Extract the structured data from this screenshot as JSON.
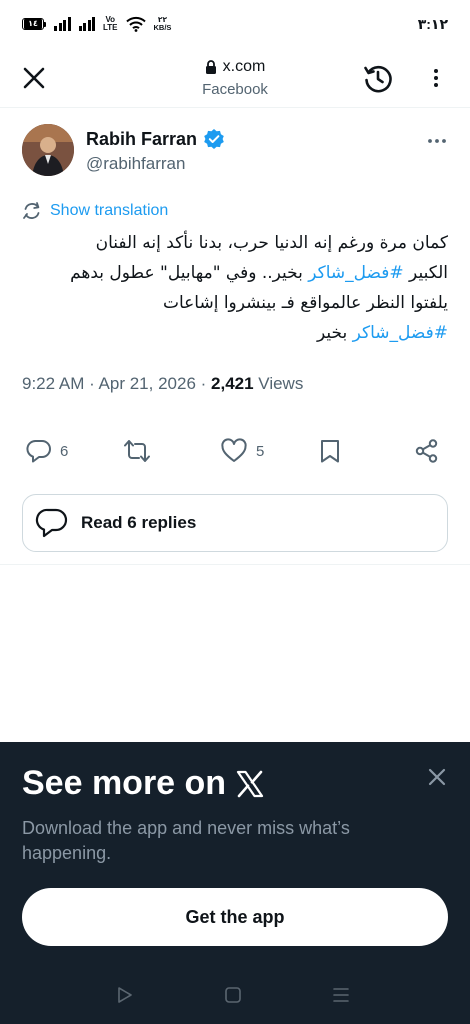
{
  "status_bar": {
    "battery_level": "١٤",
    "volte_line1": "Vo",
    "volte_line2": "LTE",
    "net_speed_value": "٢٢",
    "net_speed_unit": "KB/S",
    "time": "٣:١٢"
  },
  "top_bar": {
    "url": "x.com",
    "subtitle": "Facebook",
    "icons": [
      "close-icon",
      "lock-icon",
      "history-icon",
      "more-vertical-icon"
    ]
  },
  "tweet": {
    "author_name": "Rabih Farran",
    "author_handle": "@rabihfarran",
    "verified": true,
    "show_translation": "Show translation",
    "text_line1": "كمان مرة ورغم إنه الدنيا حرب، بدنا نأكد إنه الفنان",
    "text_line2_pre": "الكبير ",
    "hashtag1": "#فضل_شاكر",
    "text_line2_post": " بخير.. وفي \"مهابيل\" عطول بدهم",
    "text_line3": "يلفتوا النظر عالمواقع فـ بينشروا إشاعات",
    "hashtag2": "#فضل_شاكر",
    "text_line4_post": " بخير",
    "time": "9:22 AM",
    "date": "Apr 21, 2026",
    "views_count": "2,421",
    "views_label": "Views",
    "reply_count": "6",
    "like_count": "5",
    "read_replies": "Read 6 replies"
  },
  "promo": {
    "title": "See more on",
    "description": "Download the app and never miss what’s happening.",
    "button": "Get the app"
  },
  "colors": {
    "accent": "#1d9bf0",
    "text": "#0f1419",
    "muted": "#536471",
    "promo_bg": "#15202b"
  }
}
